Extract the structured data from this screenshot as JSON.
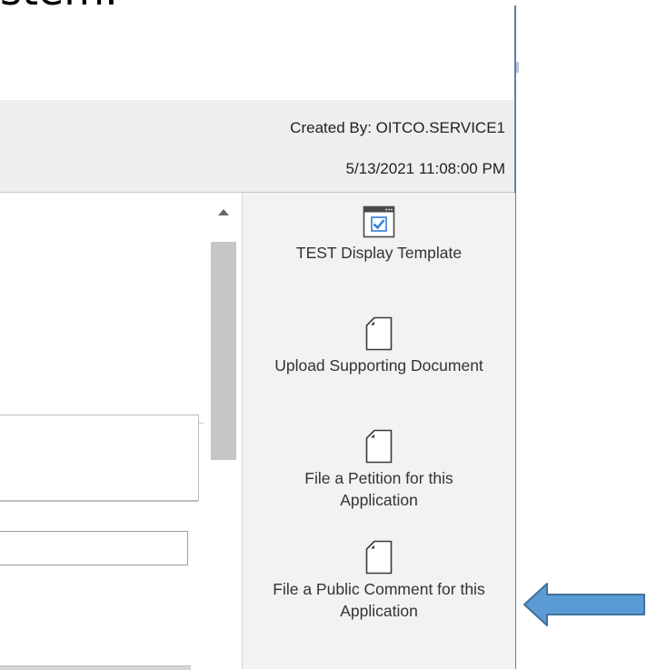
{
  "slide": {
    "title_fragment": "stem."
  },
  "header": {
    "created_by": "Created By: OITCO.SERVICE1",
    "created_date": "5/13/2021 11:08:00 PM"
  },
  "actions": {
    "items": [
      {
        "icon": "display-template-icon",
        "label": "TEST Display Template"
      },
      {
        "icon": "document-icon",
        "label": "Upload Supporting Document"
      },
      {
        "icon": "document-icon",
        "label": "File a Petition for this Application"
      },
      {
        "icon": "document-icon",
        "label": "File a Public Comment for this Application"
      }
    ]
  },
  "colors": {
    "arrow_fill": "#5b9bd5",
    "arrow_stroke": "#41719c",
    "template_check": "#2f7bd8",
    "frame_border": "#5b7fb0"
  }
}
